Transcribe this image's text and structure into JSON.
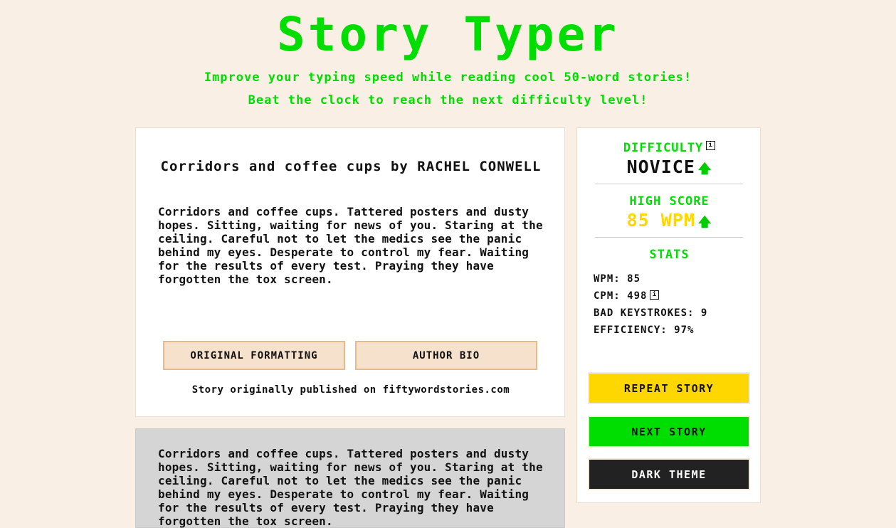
{
  "header": {
    "title": "Story Typer",
    "subtitle_line1": "Improve your typing speed while reading cool 50-word stories!",
    "subtitle_line2": "Beat the clock to reach the next difficulty level!"
  },
  "story": {
    "title": "Corridors and coffee cups by RACHEL CONWELL",
    "text": "Corridors and coffee cups. Tattered posters and dusty hopes. Sitting, waiting for news of you. Staring at the ceiling. Careful not to let the medics see the panic behind my eyes. Desperate to control my fear. Waiting for the results of every test. Praying they have forgotten the tox screen.",
    "original_formatting_label": "ORIGINAL FORMATTING",
    "author_bio_label": "AUTHOR BIO",
    "published_prefix": "Story originally published on",
    "published_site": "fiftywordstories.com"
  },
  "typing_area": {
    "text": "Corridors and coffee cups. Tattered posters and dusty hopes. Sitting, waiting for news of you. Staring at the ceiling. Careful not to let the medics see the panic behind my eyes. Desperate to control my fear. Waiting for the results of every test. Praying they have forgotten the tox screen."
  },
  "sidebar": {
    "difficulty_label": "DIFFICULTY",
    "difficulty_value": "NOVICE",
    "high_score_label": "HIGH SCORE",
    "high_score_value": "85 WPM",
    "stats_label": "STATS",
    "stats": {
      "wpm": "WPM: 85",
      "cpm": "CPM: 498",
      "bad_keystrokes": "BAD KEYSTROKES: 9",
      "efficiency": "EFFICIENCY: 97%"
    },
    "info_icon_glyph": "i",
    "arrow_glyph": "🡅",
    "buttons": {
      "repeat": "REPEAT STORY",
      "next": "NEXT STORY",
      "dark": "DARK THEME"
    }
  },
  "colors": {
    "accent_green": "#00dd00",
    "gold": "#ffd700",
    "background": "#f9efe4"
  }
}
